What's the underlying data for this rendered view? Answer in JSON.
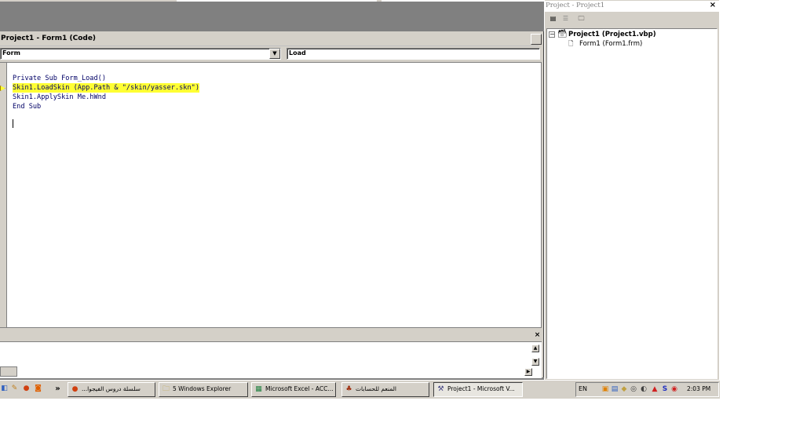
{
  "code_window": {
    "title": "Project1 - Form1 (Code)",
    "object_combo": "Form",
    "procedure_combo": "Load",
    "lines": [
      "Private Sub Form_Load()",
      "Skin1.LoadSkin (App.Path & \"/skin/yasser.skn\")",
      "Skin1.ApplySkin Me.hWnd",
      "End Sub"
    ]
  },
  "project_explorer": {
    "title": "Project - Project1",
    "close_label": "×",
    "root": "Project1 (Project1.vbp)",
    "form": "Form1 (Form1.frm)"
  },
  "immediate": {
    "close_label": "×"
  },
  "taskbar": {
    "more_label": "»",
    "items": [
      "...سلسلة دروس الفيجوا",
      "5 Windows Explorer",
      "Microsoft Excel - ACC...",
      "المنعم للحسابات",
      "Project1 - Microsoft V..."
    ],
    "lang": "EN",
    "clock": "2:03 PM"
  },
  "colors": {
    "highlight": "#ffff33",
    "code_text": "#000066",
    "chrome": "#d4d0c8"
  }
}
